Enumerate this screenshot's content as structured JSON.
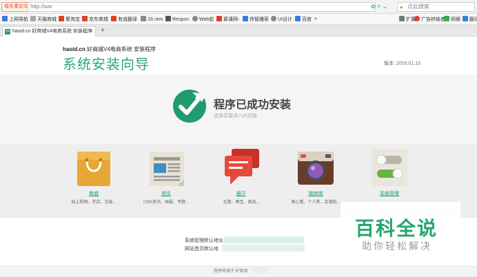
{
  "browser": {
    "redirect_label": "域名重定向",
    "url": "http://ww",
    "search_placeholder": "点此搜索",
    "bookmarks": [
      {
        "label": "上网导航",
        "color": "#3b7bd9"
      },
      {
        "label": "天猫商城",
        "color": "#aaaaaa"
      },
      {
        "label": "聚淘宝",
        "color": "#d9412b"
      },
      {
        "label": "京东商城",
        "color": "#d9412b"
      },
      {
        "label": "有道翻译",
        "color": "#d9412b"
      },
      {
        "label": "JS rem",
        "color": "#888888"
      },
      {
        "label": "Respon",
        "color": "#555555"
      },
      {
        "label": "Web前",
        "color": "#888888"
      },
      {
        "label": "慕课网-",
        "color": "#d9412b"
      },
      {
        "label": "传智播客",
        "color": "#3b7bd9"
      },
      {
        "label": "UI设计",
        "color": "#888888"
      },
      {
        "label": "百度",
        "color": "#3b7bd9"
      }
    ],
    "bookmarks_more": "»",
    "right_tools": [
      {
        "label": "扩展",
        "icon": "grid-icon"
      },
      {
        "label": "广告终结者",
        "icon": "shield-icon"
      },
      {
        "label": "网银",
        "icon": "bank-icon"
      },
      {
        "label": "翻译",
        "icon": "translate-icon"
      }
    ],
    "tab": {
      "favicon": "V4",
      "title": "haoid.cn 好商城V4电商系统 安装程序"
    },
    "new_tab": "+"
  },
  "header": {
    "brand_bold": "haoid.cn",
    "brand_rest": " 好商城V4电商系统 安装程序",
    "title": "系统安装向导",
    "version": "版本: 2016.01.13"
  },
  "success": {
    "title": "程序已成功安装",
    "subtitle": "选择您要进入的页面"
  },
  "modules": [
    {
      "name": "商城",
      "desc": "线上购物、开店、交易...",
      "icon": "shopping-bag-icon"
    },
    {
      "name": "资讯",
      "desc": "CMS资讯、画报、专题...",
      "icon": "newspaper-icon"
    },
    {
      "name": "圈子",
      "desc": "主题、晒宝、商品...",
      "icon": "chat-bubble-icon"
    },
    {
      "name": "微商城",
      "desc": "随心看、个人秀、店铺街...",
      "icon": "camera-icon"
    },
    {
      "name": "系统管理",
      "desc": "",
      "icon": "toggle-switch-icon"
    }
  ],
  "info": {
    "admin_line": "系统管理默认地址",
    "home_line": "网站首页默认地"
  },
  "footer": {
    "text": "程序来源于 好商城"
  },
  "watermark": {
    "main": "百科全说",
    "sub": "助你轻松解决"
  },
  "colors": {
    "accent": "#2aa67a",
    "bg_band": "#f5f5f5"
  }
}
